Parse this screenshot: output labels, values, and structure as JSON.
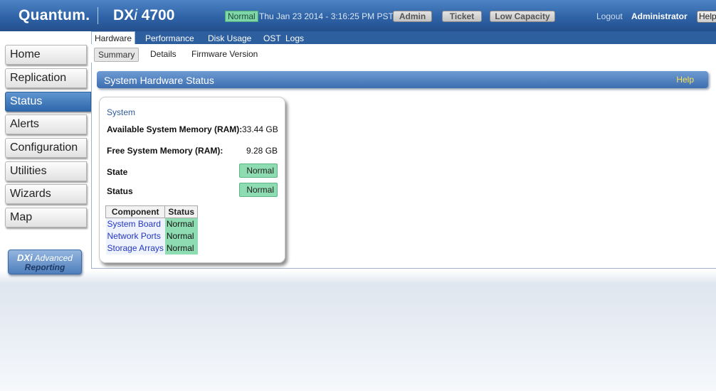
{
  "header": {
    "logo": "Quantum.",
    "product_prefix": "DX",
    "product_italic": "i",
    "product_model": " 4700",
    "system_status": "Normal",
    "datetime": "Thu Jan 23 2014 - 3:16:25 PM PST",
    "buttons": {
      "admin": "Admin",
      "ticket": "Ticket",
      "low_capacity": "Low Capacity"
    },
    "logout": "Logout",
    "user": "Administrator",
    "help": "Help",
    "colors": {
      "bar": "#2f63a7",
      "status_ok": "#7fd6a9"
    }
  },
  "tabs": {
    "primary": [
      "Hardware",
      "Performance",
      "Disk Usage",
      "OST",
      "Logs"
    ],
    "secondary": [
      "Summary",
      "Details",
      "Firmware Version"
    ]
  },
  "sidebar": {
    "items": [
      {
        "label": "Home"
      },
      {
        "label": "Replication"
      },
      {
        "label": "Status"
      },
      {
        "label": "Alerts"
      },
      {
        "label": "Configuration"
      },
      {
        "label": "Utilities"
      },
      {
        "label": "Wizards"
      },
      {
        "label": "Map"
      }
    ],
    "active": "Status",
    "advanced_reporting": {
      "line1_bold": "DXi",
      "line1": " Advanced",
      "line2": "Reporting"
    }
  },
  "main": {
    "section_title": "System Hardware Status",
    "help": "Help",
    "system": {
      "heading": "System",
      "available_memory_label": "Available System Memory (RAM):",
      "available_memory_value": "33.44 GB",
      "free_memory_label": "Free System Memory (RAM):",
      "free_memory_value": "9.28 GB",
      "state_label": "State",
      "state_value": "Normal",
      "status_label": "Status",
      "status_value": "Normal"
    },
    "components": {
      "headers": [
        "Component",
        "Status"
      ],
      "rows": [
        {
          "name": "System Board",
          "status": "Normal"
        },
        {
          "name": "Network Ports",
          "status": "Normal"
        },
        {
          "name": "Storage Arrays",
          "status": "Normal"
        }
      ]
    }
  }
}
